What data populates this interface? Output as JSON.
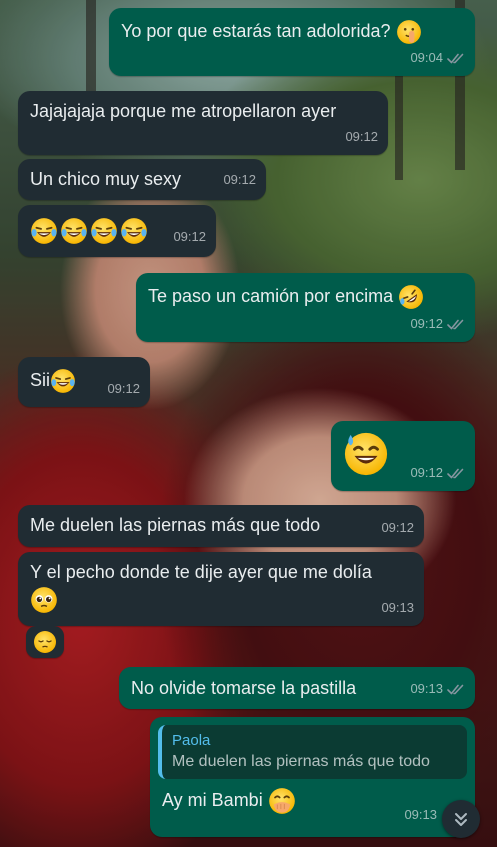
{
  "messages": [
    {
      "text": "Yo por que estarás tan adolorida?",
      "time": "09:04",
      "emoji": "shushing-face"
    },
    {
      "text": "Jajajajaja porque me atropellaron ayer",
      "time": "09:12"
    },
    {
      "text": "Un chico muy sexy",
      "time": "09:12"
    },
    {
      "text": "",
      "time": "09:12",
      "emoji": "face-with-tears-of-joy x4"
    },
    {
      "text": "Te paso un camión por encima",
      "time": "09:12",
      "emoji": "rolling-on-the-floor-laughing"
    },
    {
      "text": "Sii",
      "time": "09:12",
      "emoji": "face-with-tears-of-joy"
    },
    {
      "text": "",
      "time": "09:12",
      "emoji": "grinning-face-with-sweat"
    },
    {
      "text": "Me duelen las piernas más que todo",
      "time": "09:12"
    },
    {
      "text": "Y el pecho donde te dije ayer que me dolía",
      "time": "09:13",
      "emoji": "pleading-face"
    },
    {
      "text": "",
      "time": "",
      "emoji": "pensive-face"
    },
    {
      "text": "No olvide tomarse la pastilla",
      "time": "09:13"
    },
    {
      "reply_name": "Paola",
      "reply_text": "Me duelen las piernas más que todo",
      "text": "Ay mi Bambi",
      "time": "09:13",
      "emoji": "face-with-hand-over-mouth"
    }
  ],
  "colors": {
    "incoming_bubble": "#202c33",
    "outgoing_bubble": "#005c4b",
    "reply_accent": "#53bdeb",
    "tick": "#8696a0"
  },
  "scroll_button": {
    "icon": "double-chevron-down-icon"
  }
}
